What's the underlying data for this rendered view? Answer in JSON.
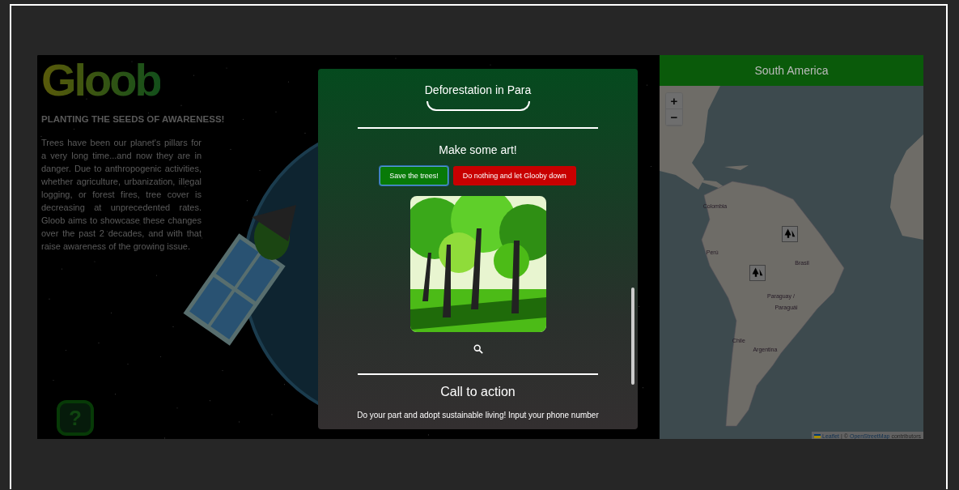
{
  "intro": {
    "logo": "Gloob",
    "heading": "PLANTING THE SEEDS OF AWARENESS!",
    "body": "Trees have been our planet's pillars for a very long time...and now they are in danger. Due to anthropogenic activities, whether agriculture, urbanization, illegal logging, or forest fires, tree cover is decreasing at unprecedented rates. Gloob aims to showcase these changes over the past 2 decades, and with that raise awareness of the growing issue."
  },
  "help_button": {
    "label": "?"
  },
  "modal": {
    "title": "Deforestation in Para",
    "art_heading": "Make some art!",
    "buttons": [
      {
        "label": "Save the trees!",
        "kind": "save",
        "focused": true
      },
      {
        "label": "Do nothing and let Glooby down",
        "kind": "danger",
        "focused": false
      }
    ],
    "cta_heading": "Call to action",
    "cta_text": "Do your part and adopt sustainable living! Input your phone number"
  },
  "map": {
    "title": "South America",
    "zoom_in": "+",
    "zoom_out": "−",
    "labels": [
      "Colombia",
      "Perú",
      "Brasil",
      "Paraguay /",
      "Paraguái",
      "Chile",
      "Argentina"
    ],
    "attribution": {
      "link1": "Leaflet",
      "separator": "| ©",
      "link2": "OpenStreetMap",
      "rest": "contributors"
    }
  }
}
